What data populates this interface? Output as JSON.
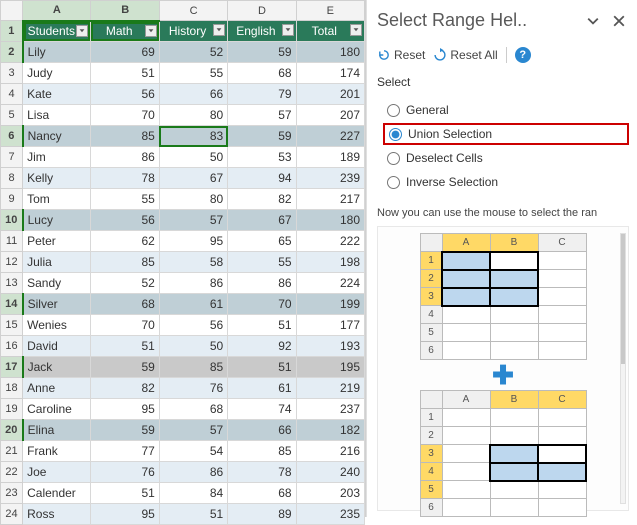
{
  "sheet": {
    "columns": [
      "A",
      "B",
      "C",
      "D",
      "E"
    ],
    "headers": [
      "Students",
      "Math",
      "History",
      "English",
      "Total"
    ],
    "rows": [
      {
        "n": 2,
        "name": "Lily",
        "math": 69,
        "history": 52,
        "english": 59,
        "total": 180,
        "sel": true
      },
      {
        "n": 3,
        "name": "Judy",
        "math": 51,
        "history": 55,
        "english": 68,
        "total": 174
      },
      {
        "n": 4,
        "name": "Kate",
        "math": 56,
        "history": 66,
        "english": 79,
        "total": 201
      },
      {
        "n": 5,
        "name": "Lisa",
        "math": 70,
        "history": 80,
        "english": 57,
        "total": 207
      },
      {
        "n": 6,
        "name": "Nancy",
        "math": 85,
        "history": 83,
        "english": 59,
        "total": 227,
        "sel": true,
        "active_c": true
      },
      {
        "n": 7,
        "name": "Jim",
        "math": 86,
        "history": 50,
        "english": 53,
        "total": 189
      },
      {
        "n": 8,
        "name": "Kelly",
        "math": 78,
        "history": 67,
        "english": 94,
        "total": 239
      },
      {
        "n": 9,
        "name": "Tom",
        "math": 55,
        "history": 80,
        "english": 82,
        "total": 217
      },
      {
        "n": 10,
        "name": "Lucy",
        "math": 56,
        "history": 57,
        "english": 67,
        "total": 180,
        "sel": true
      },
      {
        "n": 11,
        "name": "Peter",
        "math": 62,
        "history": 95,
        "english": 65,
        "total": 222
      },
      {
        "n": 12,
        "name": "Julia",
        "math": 85,
        "history": 58,
        "english": 55,
        "total": 198
      },
      {
        "n": 13,
        "name": "Sandy",
        "math": 52,
        "history": 86,
        "english": 86,
        "total": 224
      },
      {
        "n": 14,
        "name": "Silver",
        "math": 68,
        "history": 61,
        "english": 70,
        "total": 199,
        "sel": true
      },
      {
        "n": 15,
        "name": "Wenies",
        "math": 70,
        "history": 56,
        "english": 51,
        "total": 177
      },
      {
        "n": 16,
        "name": "David",
        "math": 51,
        "history": 50,
        "english": 92,
        "total": 193
      },
      {
        "n": 17,
        "name": "Jack",
        "math": 59,
        "history": 85,
        "english": 51,
        "total": 195,
        "sel": true
      },
      {
        "n": 18,
        "name": "Anne",
        "math": 82,
        "history": 76,
        "english": 61,
        "total": 219
      },
      {
        "n": 19,
        "name": "Caroline",
        "math": 95,
        "history": 68,
        "english": 74,
        "total": 237
      },
      {
        "n": 20,
        "name": "Elina",
        "math": 59,
        "history": 57,
        "english": 66,
        "total": 182,
        "sel": true
      },
      {
        "n": 21,
        "name": "Frank",
        "math": 77,
        "history": 54,
        "english": 85,
        "total": 216
      },
      {
        "n": 22,
        "name": "Joe",
        "math": 76,
        "history": 86,
        "english": 78,
        "total": 240
      },
      {
        "n": 23,
        "name": "Calender",
        "math": 51,
        "history": 84,
        "english": 68,
        "total": 203
      },
      {
        "n": 24,
        "name": "Ross",
        "math": 95,
        "history": 51,
        "english": 89,
        "total": 235
      }
    ]
  },
  "pane": {
    "title": "Select Range Hel..",
    "reset": "Reset",
    "reset_all": "Reset All",
    "section": "Select",
    "options": {
      "general": "General",
      "union": "Union Selection",
      "deselect": "Deselect Cells",
      "inverse": "Inverse Selection"
    },
    "hint": "Now you can use the mouse to select the ran"
  },
  "mini1": {
    "cols": [
      "A",
      "B",
      "C"
    ],
    "rows": [
      "1",
      "2",
      "3",
      "4",
      "5",
      "6"
    ]
  },
  "mini2": {
    "cols": [
      "A",
      "B",
      "C"
    ],
    "rows": [
      "1",
      "2",
      "3",
      "4",
      "5",
      "6"
    ]
  }
}
